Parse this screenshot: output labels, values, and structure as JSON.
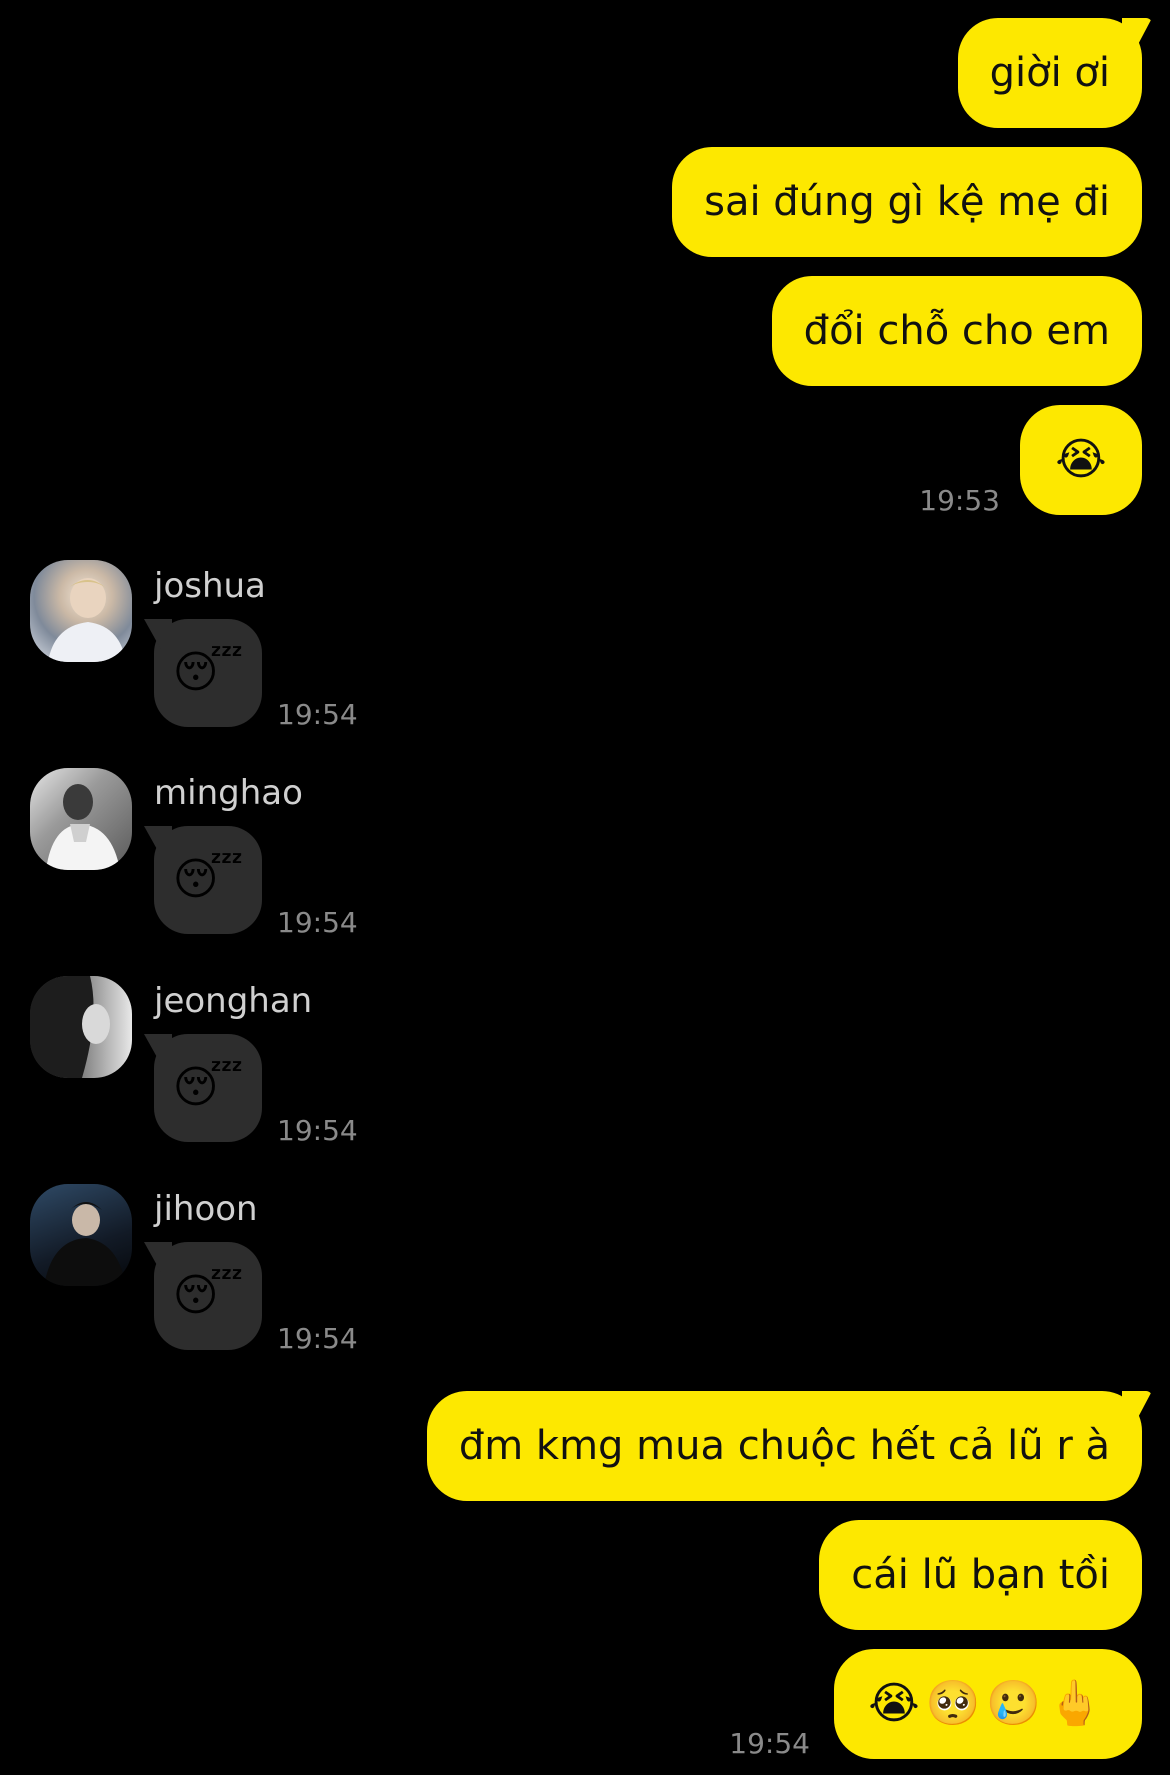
{
  "colors": {
    "background": "#000000",
    "outgoing_bubble": "#fde800",
    "incoming_bubble": "#2d2d2d",
    "timestamp": "#8a8a8a"
  },
  "outgoing_group_1": {
    "messages": [
      "giời ơi",
      "sai đúng gì kệ mẹ đi",
      "đổi chỗ cho em",
      "😭"
    ],
    "time": "19:53"
  },
  "incoming": [
    {
      "sender": "joshua",
      "avatar_icon": "avatar-joshua",
      "message": "😴",
      "time": "19:54"
    },
    {
      "sender": "minghao",
      "avatar_icon": "avatar-minghao",
      "message": "😴",
      "time": "19:54"
    },
    {
      "sender": "jeonghan",
      "avatar_icon": "avatar-jeonghan",
      "message": "😴",
      "time": "19:54"
    },
    {
      "sender": "jihoon",
      "avatar_icon": "avatar-jihoon",
      "message": "😴",
      "time": "19:54"
    }
  ],
  "outgoing_group_2": {
    "messages": [
      "đm kmg mua chuộc hết cả lũ r à",
      "cái lũ bạn tồi",
      "😭🥺🥲🖕"
    ],
    "time": "19:54"
  }
}
